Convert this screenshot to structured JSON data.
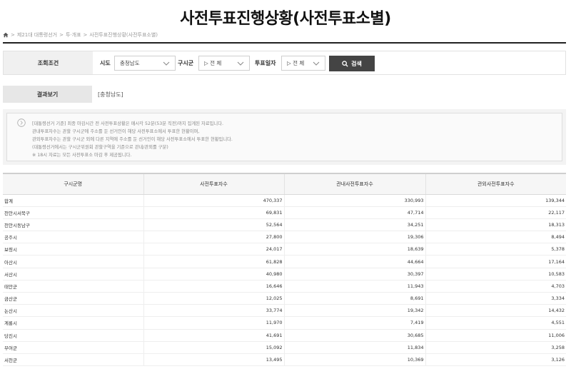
{
  "page": {
    "title": "사전투표진행상황(사전투표소별)"
  },
  "breadcrumb": {
    "items": [
      "제21대 대통령선거",
      "투·개표",
      "사전투표진행상황(사전투표소별)"
    ],
    "separator": ">"
  },
  "search": {
    "label": "조회조건",
    "sido_label": "시도",
    "sido_value": "충청남도",
    "sigungu_label": "구시군",
    "sigungu_value": "▷ 전 체",
    "date_label": "투표일자",
    "date_value": "▷ 전 체",
    "button_label": "검색"
  },
  "result": {
    "label": "결과보기",
    "value": "[충청남도]"
  },
  "notice": {
    "lines": [
      "[대통령선거 기준] 최종 마감시간 전 사전투표상황은 매시각 52분(53분 직전)까지 집계된 자료입니다.",
      "관내투표자수는 관할 구시군에 주소를 둔 선거인이 해당 사전투표소에서 투표한 현황이며,",
      "관외투표자수는 관할 구시군 외에 다른 지역에 주소를 둔 선거인이 해당 사전투표소에서 투표한 현황입니다.",
      "(대통령선거에서는 구시군위원회 관할구역을 기준으로 관내/관외를 구분)",
      "※ 18시 자료는 모든 사전투표소 마감 후 제공됩니다."
    ]
  },
  "table": {
    "headers": [
      "구시군명",
      "사전투표자수",
      "관내사전투표자수",
      "관외사전투표자수"
    ],
    "rows": [
      [
        "합계",
        "470,337",
        "330,993",
        "139,344"
      ],
      [
        "천안시서북구",
        "69,831",
        "47,714",
        "22,117"
      ],
      [
        "천안시동남구",
        "52,564",
        "34,251",
        "18,313"
      ],
      [
        "공주시",
        "27,800",
        "19,306",
        "8,494"
      ],
      [
        "보령시",
        "24,017",
        "18,639",
        "5,378"
      ],
      [
        "아산시",
        "61,828",
        "44,664",
        "17,164"
      ],
      [
        "서산시",
        "40,980",
        "30,397",
        "10,583"
      ],
      [
        "태안군",
        "16,646",
        "11,943",
        "4,703"
      ],
      [
        "금산군",
        "12,025",
        "8,691",
        "3,334"
      ],
      [
        "논산시",
        "33,774",
        "19,342",
        "14,432"
      ],
      [
        "계룡시",
        "11,970",
        "7,419",
        "4,551"
      ],
      [
        "당진시",
        "41,691",
        "30,685",
        "11,006"
      ],
      [
        "부여군",
        "15,092",
        "11,834",
        "3,258"
      ],
      [
        "서천군",
        "13,495",
        "10,369",
        "3,126"
      ]
    ]
  },
  "colors": {
    "button_bg": "#444444",
    "header_bg": "#f6f6f6",
    "label_bg": "#f0f0f0"
  },
  "icons": [
    "home-icon",
    "chevron-down-icon",
    "search-icon",
    "info-icon"
  ]
}
